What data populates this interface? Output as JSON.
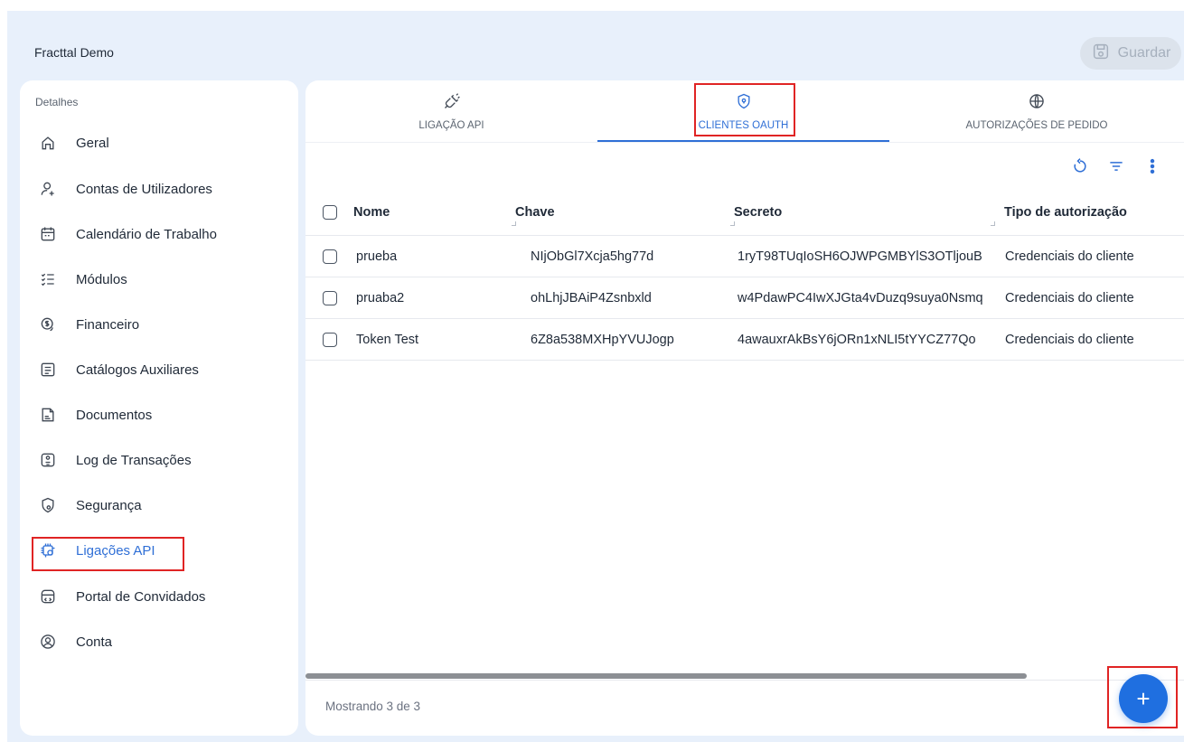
{
  "app": {
    "title": "Fracttal Demo"
  },
  "toolbar": {
    "save_label": "Guardar"
  },
  "sidebar": {
    "header": "Detalhes",
    "items": [
      {
        "label": "Geral",
        "icon": "home-icon"
      },
      {
        "label": "Contas de Utilizadores",
        "icon": "add-user-icon"
      },
      {
        "label": "Calendário de Trabalho",
        "icon": "calendar-icon"
      },
      {
        "label": "Módulos",
        "icon": "checklist-icon"
      },
      {
        "label": "Financeiro",
        "icon": "money-icon"
      },
      {
        "label": "Catálogos Auxiliares",
        "icon": "catalog-icon"
      },
      {
        "label": "Documentos",
        "icon": "document-icon"
      },
      {
        "label": "Log de Transações",
        "icon": "log-icon"
      },
      {
        "label": "Segurança",
        "icon": "shield-icon"
      },
      {
        "label": "Ligações API",
        "icon": "api-chip-icon",
        "active": true
      },
      {
        "label": "Portal de Convidados",
        "icon": "portal-icon"
      },
      {
        "label": "Conta",
        "icon": "account-icon"
      }
    ]
  },
  "tabs": [
    {
      "label": "LIGAÇÃO API",
      "icon": "plug-icon"
    },
    {
      "label": "CLIENTES OAUTH",
      "icon": "shield-lock-icon",
      "active": true
    },
    {
      "label": "AUTORIZAÇÕES DE PEDIDO",
      "icon": "globe-icon"
    }
  ],
  "table": {
    "columns": [
      "Nome",
      "Chave",
      "Secreto",
      "Tipo de autorização"
    ],
    "rows": [
      [
        "prueba",
        "NIjObGl7Xcja5hg77d",
        "1ryT98TUqIoSH6OJWPGMBYlS3OTljouB",
        "Credenciais do cliente"
      ],
      [
        "pruaba2",
        "ohLhjJBAiP4Zsnbxld",
        "w4PdawPC4IwXJGta4vDuzq9suya0Nsmq",
        "Credenciais do cliente"
      ],
      [
        "Token Test",
        "6Z8a538MXHpYVUJogp",
        "4awauxrAkBsY6jORn1xNLI5tYYCZ77Qo",
        "Credenciais do cliente"
      ]
    ]
  },
  "footer": {
    "showing": "Mostrando 3 de 3"
  },
  "fab": {
    "label": "+"
  },
  "colors": {
    "accent": "#2f6fd6",
    "fab": "#1f6fe0",
    "highlight": "#e02424",
    "background": "#e8f0fb"
  }
}
